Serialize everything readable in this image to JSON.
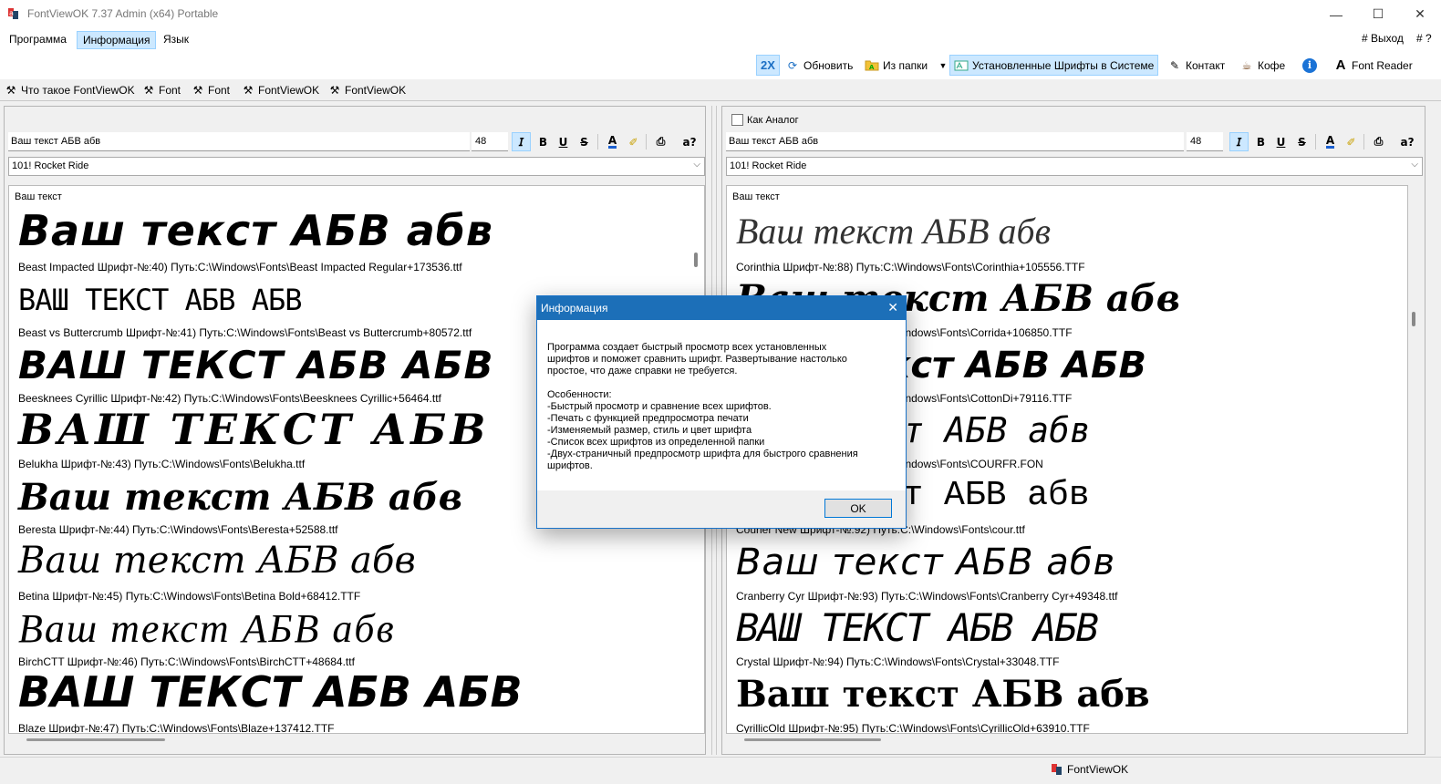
{
  "window": {
    "title": "FontViewOK 7.37 Admin (x64) Portable"
  },
  "menu": {
    "items": [
      "Программа",
      "Информация",
      "Язык"
    ],
    "active_index": 1,
    "exit_label": "# Выход",
    "help_label": "# ?"
  },
  "toolbar": {
    "zoom_label": "2X",
    "refresh_label": "Обновить",
    "from_folder_label": "Из папки",
    "installed_fonts_label": "Установленные Шрифты в Системе",
    "contact_label": "Контакт",
    "coffee_label": "Кофе",
    "font_reader_label": "Font Reader"
  },
  "history": {
    "items": [
      "Что такое FontViewOK",
      "Font",
      "Font",
      "FontViewOK",
      "FontViewOK"
    ]
  },
  "left_pane": {
    "text_value": "Ваш текст АБВ абв",
    "size_value": "48",
    "font_selected": "101! Rocket Ride",
    "preview_header": "Ваш текст",
    "fonts": [
      {
        "sample": "Ваш текст АБВ абв",
        "caption": "Beast Impacted Шрифт-№:40) Путь:C:\\Windows\\Fonts\\Beast Impacted Regular+173536.ttf"
      },
      {
        "sample": "ВАШ ТЕКСТ АБВ АБВ",
        "caption": "Beast vs Buttercrumb Шрифт-№:41) Путь:C:\\Windows\\Fonts\\Beast vs Buttercrumb+80572.ttf"
      },
      {
        "sample": "ВАШ ТЕКСТ АБВ АБВ",
        "caption": "Beesknees Cyrillic Шрифт-№:42) Путь:C:\\Windows\\Fonts\\Beesknees Cyrillic+56464.ttf"
      },
      {
        "sample": "ВАШ ТЕКСТ АБВ",
        "caption": "Belukha Шрифт-№:43) Путь:C:\\Windows\\Fonts\\Belukha.ttf"
      },
      {
        "sample": "Ваш текст АБВ абв",
        "caption": "Beresta Шрифт-№:44) Путь:C:\\Windows\\Fonts\\Beresta+52588.ttf"
      },
      {
        "sample": "Ваш текст АБВ абв",
        "caption": "Betina Шрифт-№:45) Путь:C:\\Windows\\Fonts\\Betina Bold+68412.TTF"
      },
      {
        "sample": "Ваш текст АБВ абв",
        "caption": "BirchCTT Шрифт-№:46) Путь:C:\\Windows\\Fonts\\BirchCTT+48684.ttf"
      },
      {
        "sample": "ВАШ ТЕКСТ АБВ АБВ",
        "caption": "Blaze Шрифт-№:47) Путь:C:\\Windows\\Fonts\\Blaze+137412.TTF"
      }
    ]
  },
  "right_pane": {
    "as_analog_label": "Как Аналог",
    "text_value": "Ваш текст АБВ абв",
    "size_value": "48",
    "font_selected": "101! Rocket Ride",
    "preview_header": "Ваш текст",
    "fonts": [
      {
        "sample": "Ваш текст АБВ абв",
        "caption": "Corinthia Шрифт-№:88) Путь:C:\\Windows\\Fonts\\Corinthia+105556.TTF"
      },
      {
        "sample": "Ваш текст АБВ абв",
        "caption": "Vindows\\Fonts\\Corrida+106850.TTF"
      },
      {
        "sample": "Ваш текст АБВ АБВ",
        "caption": "Vindows\\Fonts\\CottonDi+79116.TTF"
      },
      {
        "sample": "ваш текст АБВ абв",
        "caption": "Vindows\\Fonts\\COURFR.FON"
      },
      {
        "sample": "Ваш текст АБВ абв",
        "caption": "Courier New Шрифт-№:92) Путь:C:\\Windows\\Fonts\\cour.ttf"
      },
      {
        "sample": "Ваш текст АБВ абв",
        "caption": "Cranberry Cyr Шрифт-№:93) Путь:C:\\Windows\\Fonts\\Cranberry Cyr+49348.ttf"
      },
      {
        "sample": "ВАШ ТЕКСТ АБВ АБВ",
        "caption": "Crystal Шрифт-№:94) Путь:C:\\Windows\\Fonts\\Crystal+33048.TTF"
      },
      {
        "sample": "Ваш текст АБВ абв",
        "caption": "CyrillicOld Шрифт-№:95) Путь:C:\\Windows\\Fonts\\CyrillicOld+63910.TTF"
      }
    ]
  },
  "dialog": {
    "title": "Информация",
    "body": "Программа создает быстрый просмотр всех установленных\nшрифтов и поможет сравнить шрифт. Развертывание настолько\nпростое, что даже справки не требуется.\n\nОсобенности:\n-Быстрый просмотр и сравнение всех шрифтов.\n-Печать с функцией предпросмотра печати\n-Изменяемый размер, стиль и цвет шрифта\n-Список всех шрифтов из определенной папки\n-Двух-страничный предпросмотр шрифта для быстрого сравнения\nшрифтов.",
    "ok_label": "OK"
  },
  "statusbar": {
    "app_label": "FontViewOK"
  },
  "colors": {
    "accent": "#1c6fb8",
    "pressed_bg": "#cce8ff",
    "pressed_border": "#99d1ff"
  }
}
